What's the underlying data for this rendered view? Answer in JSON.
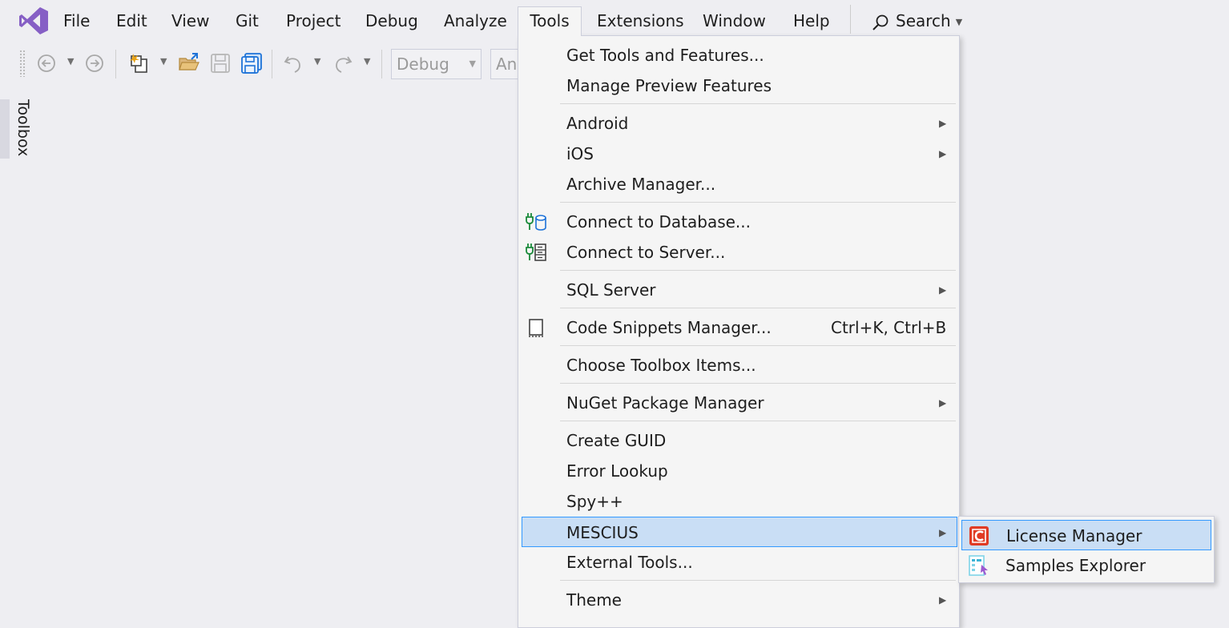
{
  "menubar": {
    "items": [
      "File",
      "Edit",
      "View",
      "Git",
      "Project",
      "Debug",
      "Analyze",
      "Tools",
      "Extensions",
      "Window",
      "Help"
    ],
    "search_label": "Search"
  },
  "toolbar": {
    "config_combo": "Debug",
    "platform_combo_partial": "An"
  },
  "toolbox": {
    "label": "Toolbox"
  },
  "tools_menu": {
    "items": {
      "get_tools": "Get Tools and Features...",
      "preview": "Manage Preview Features",
      "android": "Android",
      "ios": "iOS",
      "archive": "Archive Manager...",
      "connect_db": "Connect to Database...",
      "connect_server": "Connect to Server...",
      "sql_server": "SQL Server",
      "code_snippets": "Code Snippets Manager...",
      "code_snippets_shortcut": "Ctrl+K, Ctrl+B",
      "choose_toolbox": "Choose Toolbox Items...",
      "nuget": "NuGet Package Manager",
      "create_guid": "Create GUID",
      "error_lookup": "Error Lookup",
      "spy": "Spy++",
      "mescius": "MESCIUS",
      "external_tools": "External Tools...",
      "theme": "Theme"
    }
  },
  "mescius_submenu": {
    "license_manager": "License Manager",
    "samples_explorer": "Samples Explorer"
  },
  "colors": {
    "background": "#eeeef2",
    "menu_background": "#f5f5f5",
    "highlight": "#c9def5",
    "highlight_border": "#3399ff",
    "vs_purple": "#865fc5"
  }
}
